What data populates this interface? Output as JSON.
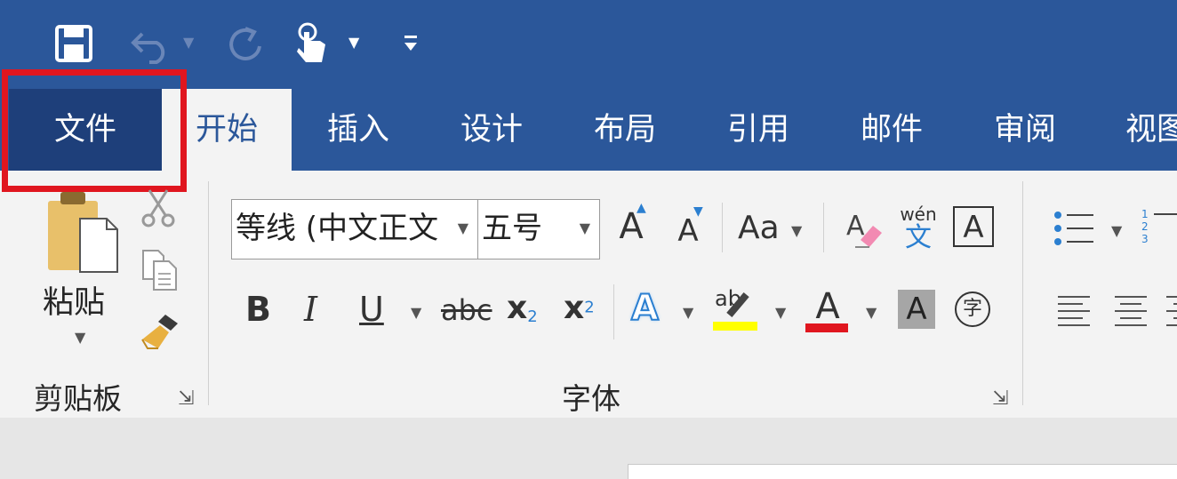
{
  "tabs": [
    "文件",
    "开始",
    "插入",
    "设计",
    "布局",
    "引用",
    "邮件",
    "审阅",
    "视图"
  ],
  "clipboard": {
    "paste_label": "粘贴",
    "group_label": "剪贴板"
  },
  "font": {
    "font_name": "等线 (中文正文",
    "font_size": "五号",
    "group_label": "字体",
    "aa_label": "Aa",
    "phonetic_top": "wén",
    "phonetic_char": "文",
    "enclose_char": "字",
    "bold": "B",
    "italic": "I",
    "underline": "U",
    "strike": "abc",
    "sub_base": "x",
    "sub_script": "2",
    "sup_base": "x",
    "sup_script": "2",
    "letter_a": "A",
    "highlight_text": "ab"
  },
  "paragraph": {
    "num_1": "1",
    "num_2": "2",
    "num_3": "3"
  },
  "colors": {
    "accent": "#2b579a",
    "file_tab": "#1e3f7a",
    "highlight_box": "#e0161f",
    "highlight_color": "#ffff00",
    "font_color": "#e0161f"
  }
}
